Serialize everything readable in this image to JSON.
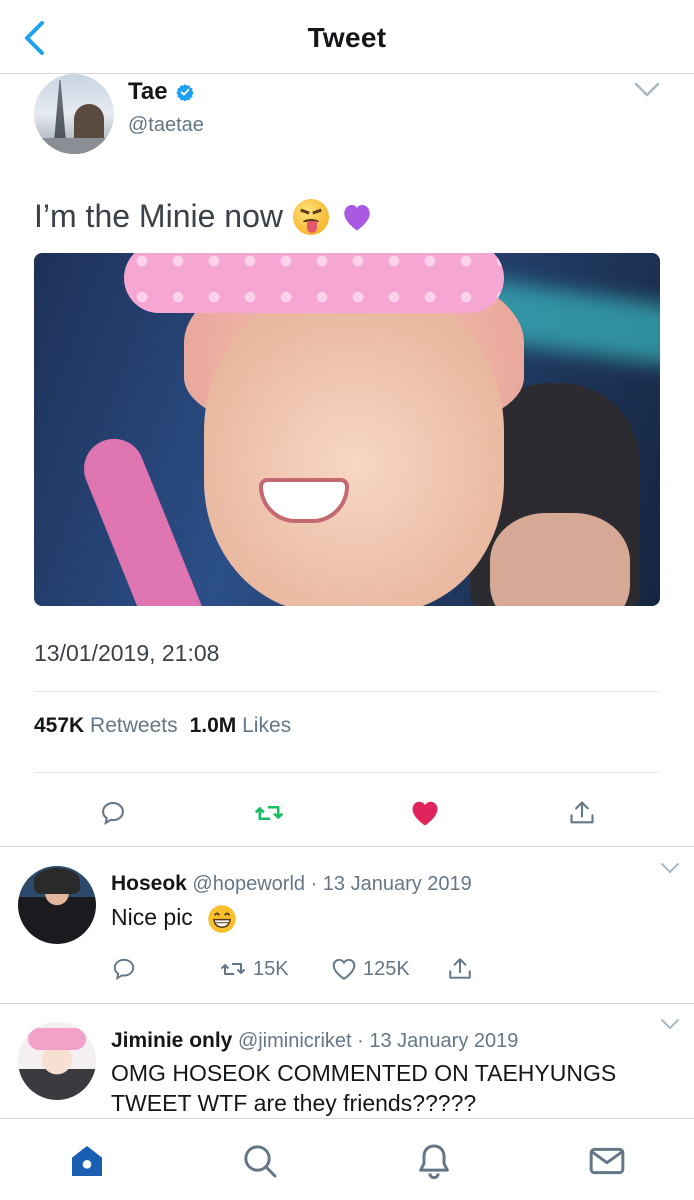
{
  "header": {
    "title": "Tweet"
  },
  "tweet": {
    "name": "Tae",
    "handle": "@taetae",
    "text": "I’m the Minie now",
    "timestamp": "13/01/2019, 21:08",
    "retweets_count": "457K",
    "retweets_label": "Retweets",
    "likes_count": "1.0M",
    "likes_label": "Likes",
    "liked": true
  },
  "colors": {
    "accent": "#1da1f2",
    "retweet_green": "#17bf63",
    "like_red": "#e0245e",
    "icon_gray": "#657786",
    "nav_active": "#1b5fb4"
  },
  "replies": [
    {
      "name": "Hoseok",
      "handle": "@hopeworld",
      "date": "· 13 January 2019",
      "text": "Nice pic",
      "retweets": "15K",
      "likes": "125K"
    },
    {
      "name": "Jiminie only",
      "handle": "@jiminicriket",
      "date": "· 13 January 2019",
      "text_line1": "OMG HOSEOK COMMENTED ON TAEHYUNGS",
      "text_line2": "TWEET WTF are they friends?????"
    }
  ],
  "icons": {
    "back": "chevron-left-icon",
    "verified": "verified-badge-icon",
    "reply": "reply-bubble-icon",
    "retweet": "retweet-icon",
    "like": "heart-icon",
    "share": "share-icon",
    "nav_home": "home-icon",
    "nav_search": "search-icon",
    "nav_notifications": "bell-icon",
    "nav_messages": "mail-icon"
  }
}
